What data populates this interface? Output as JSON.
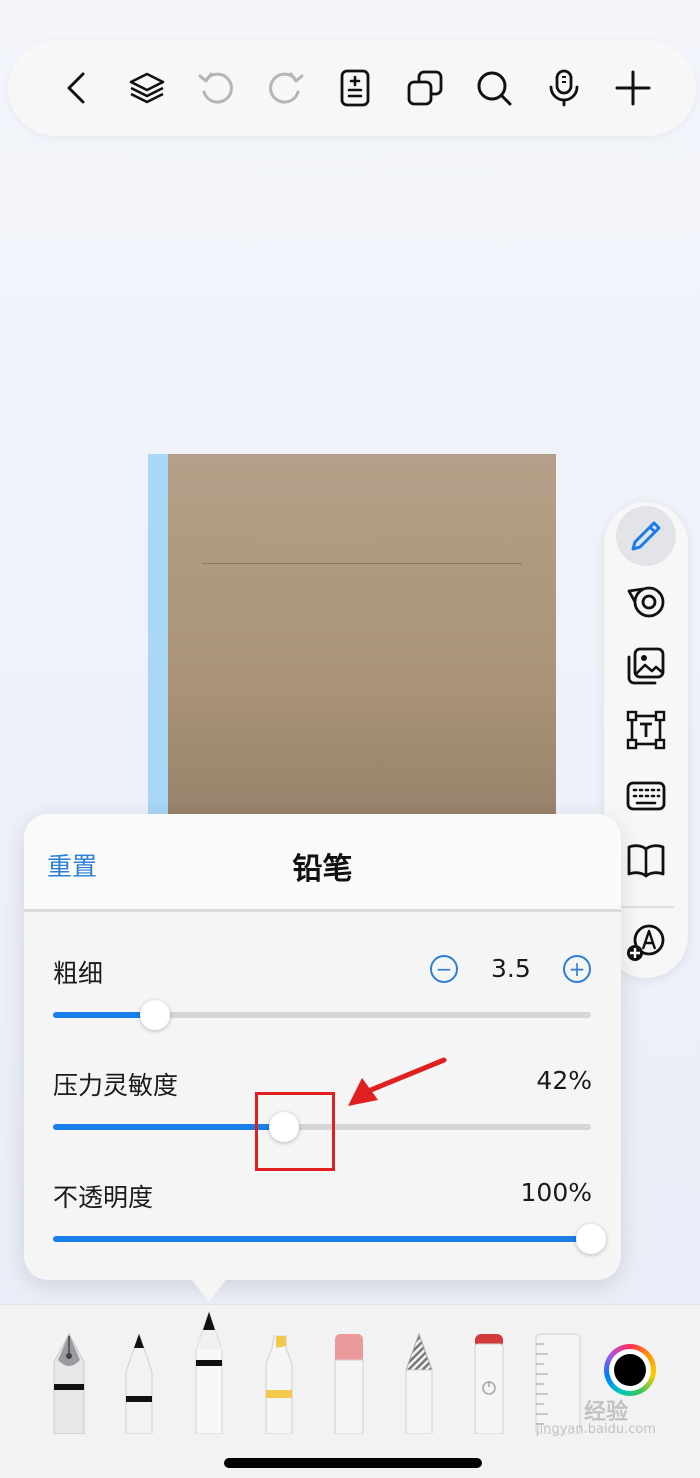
{
  "top_toolbar": {
    "icons": [
      "back-chevron-icon",
      "layers-icon",
      "undo-icon",
      "redo-icon",
      "page-settings-icon",
      "duplicate-icon",
      "search-icon",
      "microphone-icon",
      "add-icon"
    ]
  },
  "side_toolbar": {
    "icons": [
      "pencil-icon",
      "tape-icon",
      "image-icon",
      "text-box-icon",
      "keyboard-icon",
      "book-icon",
      "add-stamp-icon"
    ],
    "active": "pencil-icon"
  },
  "popover": {
    "reset_label": "重置",
    "title": "铅笔",
    "thickness": {
      "label": "粗细",
      "value": "3.5",
      "minus": "−",
      "plus": "+",
      "fraction": 0.19
    },
    "pressure": {
      "label": "压力灵敏度",
      "value": "42%",
      "fraction": 0.43
    },
    "opacity": {
      "label": "不透明度",
      "value": "100%",
      "fraction": 1.0
    }
  },
  "annotation": {
    "color": "#e02020"
  },
  "tool_tray": {
    "tools": [
      "fountain-pen",
      "ballpoint-pen",
      "pencil",
      "highlighter",
      "eraser",
      "hatch-brush",
      "power-eraser",
      "ruler"
    ],
    "selected": "pencil",
    "current_color": "#000000"
  },
  "watermark": {
    "line1": "经验",
    "line2": "jingyan.baidu.com"
  },
  "colors": {
    "accent": "#1a7ee8",
    "link": "#2b7fd4",
    "notebook": "#b4a088",
    "spine": "#a9d7f5"
  }
}
